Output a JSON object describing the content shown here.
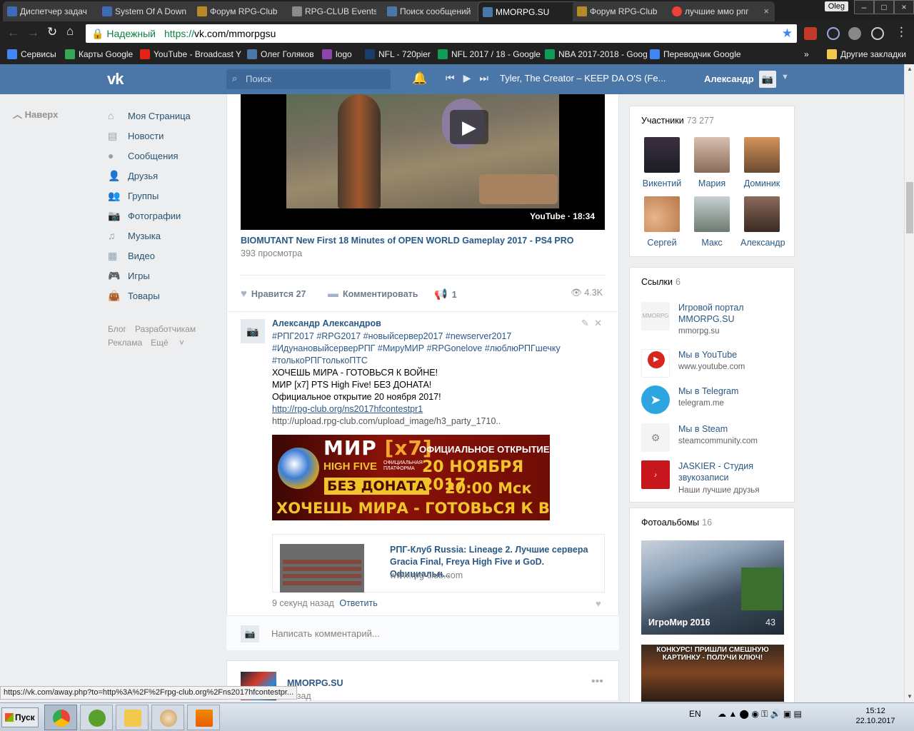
{
  "browser": {
    "tabs": [
      {
        "label": "Диспетчер задач",
        "icon_color": "#3b6cb5"
      },
      {
        "label": "System Of A Down",
        "icon_color": "#3b6cb5"
      },
      {
        "label": "Форум RPG-Club",
        "icon_color": "#b78a28"
      },
      {
        "label": "RPG-CLUB Events",
        "icon_color": "#8a8a8a"
      },
      {
        "label": "Поиск сообщений",
        "icon_color": "#4a76a8"
      },
      {
        "label": "MMORPG.SU",
        "icon_color": "#4a76a8"
      },
      {
        "label": "Форум RPG-Club",
        "icon_color": "#b78a28"
      },
      {
        "label": "лучшие ммо рпг",
        "icon_color": "#ea4335"
      }
    ],
    "profile_badge": "Oleg",
    "secure_label": "Надежный",
    "url_proto": "https://",
    "url_host": "vk.com/mmorpgsu",
    "bookmarks": [
      {
        "label": "Сервисы",
        "icon_color": "#4285f4"
      },
      {
        "label": "Карты Google",
        "icon_color": "#34a853"
      },
      {
        "label": "YouTube - Broadcast Y",
        "icon_color": "#e62117"
      },
      {
        "label": "Олег Голяков",
        "icon_color": "#4a76a8"
      },
      {
        "label": "logo",
        "icon_color": "#8e44ad"
      },
      {
        "label": "NFL - 720pier",
        "icon_color": "#1d3c6e"
      },
      {
        "label": "NFL 2017 / 18 - Google",
        "icon_color": "#0f9d58"
      },
      {
        "label": "NBA 2017-2018 - Goog",
        "icon_color": "#0f9d58"
      },
      {
        "label": "Переводчик Google",
        "icon_color": "#4285f4"
      }
    ],
    "more_bookmarks": "»",
    "other_bookmarks": "Другие закладки",
    "status_url": "https://vk.com/away.php?to=http%3A%2F%2Frpg-club.org%2Fns2017hfcontestpr..."
  },
  "vk_header": {
    "logo": "vk",
    "search_placeholder": "Поиск",
    "now_playing": "Tyler, The Creator – KEEP DA O'S (Fe...",
    "user_name": "Александр"
  },
  "left_nav": {
    "up_label": "Наверх",
    "items": [
      {
        "label": "Моя Страница",
        "icon": "home-icon"
      },
      {
        "label": "Новости",
        "icon": "news-icon"
      },
      {
        "label": "Сообщения",
        "icon": "messages-icon"
      },
      {
        "label": "Друзья",
        "icon": "friends-icon"
      },
      {
        "label": "Группы",
        "icon": "groups-icon"
      },
      {
        "label": "Фотографии",
        "icon": "camera-icon"
      },
      {
        "label": "Музыка",
        "icon": "music-icon"
      },
      {
        "label": "Видео",
        "icon": "video-icon"
      },
      {
        "label": "Игры",
        "icon": "gamepad-icon"
      },
      {
        "label": "Товары",
        "icon": "bag-icon"
      }
    ],
    "footer": {
      "blog": "Блог",
      "developers": "Разработчикам",
      "ads": "Реклама",
      "more": "Ещё"
    }
  },
  "video_post": {
    "video_label": "YouTube · 18:34",
    "title": "BIOMUTANT New First 18 Minutes of OPEN WORLD Gameplay 2017 - PS4 PRO",
    "views": "393 просмотра",
    "like_label": "Нравится",
    "like_count": "27",
    "comment_label": "Комментировать",
    "share_count": "1",
    "view_count": "4.3K"
  },
  "comment": {
    "author": "Александр Александров",
    "tags_line1": "#РПГ2017 #RPG2017 #новыйсервер2017 #newserver2017",
    "tags_line2": "#ИдунановыйсерверРПГ #МируМИР #RPGonelove #люблюРПГшечку",
    "tags_line3": "#толькоРПГтолькоПТС",
    "line1": "ХОЧЕШЬ МИРА - ГОТОВЬСЯ К ВОЙНЕ!",
    "line2": "МИР [x7] PTS High Five! БЕЗ ДОНАТА!",
    "line3": "Официальное открытие 20 ноября 2017!",
    "link1": "http://rpg-club.org/ns2017hfcontestpr1",
    "link2": "http://upload.rpg-club.com/upload_image/h3_party_1710..",
    "banner": {
      "mir": "МИР",
      "x7": "[x7]",
      "official_opening": "ОФИЦИАЛЬНОЕ ОТКРЫТИЕ",
      "high_five": "HIGH FIVE",
      "platform": "ОФИЦИАЛЬНАЯ ПЛАТФОРМА",
      "date": "20 НОЯБРЯ 2017",
      "no_donate": "БЕЗ ДОНАТА",
      "time": "20:00 Мск",
      "slogan": "ХОЧЕШЬ МИРА - ГОТОВЬСЯ К ВОЙНЕ"
    },
    "link_card": {
      "title": "РПГ-Клуб Russia: Lineage 2. Лучшие сервера Gracia Final, Freya High Five и GoD. Официальн...",
      "url": "www.rpg-club.com"
    },
    "time": "9 секунд назад",
    "reply": "Ответить",
    "write_placeholder": "Написать комментарий..."
  },
  "next_post": {
    "name": "MMORPG.SU",
    "time": "назад"
  },
  "members": {
    "title": "Участники",
    "count": "73 277",
    "people": [
      {
        "name": "Викентий",
        "color": "#2a2f3a"
      },
      {
        "name": "Мария",
        "color": "#b08a78"
      },
      {
        "name": "Доминик",
        "color": "#a8704a"
      },
      {
        "name": "Сергей",
        "color": "#d9a07a"
      },
      {
        "name": "Макс",
        "color": "#9aa3a6"
      },
      {
        "name": "Александр",
        "color": "#6b4a3a"
      }
    ]
  },
  "links": {
    "title": "Ссылки",
    "count": "6",
    "items": [
      {
        "title": "Игровой портал MMORPG.SU",
        "url": "mmorpg.su",
        "color": "#f4f4f4"
      },
      {
        "title": "Мы в YouTube",
        "url": "www.youtube.com",
        "color": "#d9261c"
      },
      {
        "title": "Мы в Telegram",
        "url": "telegram.me",
        "color": "#2ca5e0"
      },
      {
        "title": "Мы в Steam",
        "url": "steamcommunity.com",
        "color": "#f4f4f4"
      },
      {
        "title": "JASKIER - Студия звукозаписи",
        "url": "Наши лучшие друзья",
        "color": "#c8161d"
      }
    ]
  },
  "albums": {
    "title": "Фотоальбомы",
    "count": "16",
    "items": [
      {
        "name": "ИгроМир 2016",
        "count": "43"
      },
      {
        "name": "КОНКУРС! ПРИШЛИ СМЕШНУЮ КАРТИНКУ - ПОЛУЧИ КЛЮЧ!",
        "count": ""
      }
    ]
  },
  "taskbar": {
    "start_label": "Пуск",
    "lang": "EN",
    "time": "15:12",
    "date": "22.10.2017"
  }
}
